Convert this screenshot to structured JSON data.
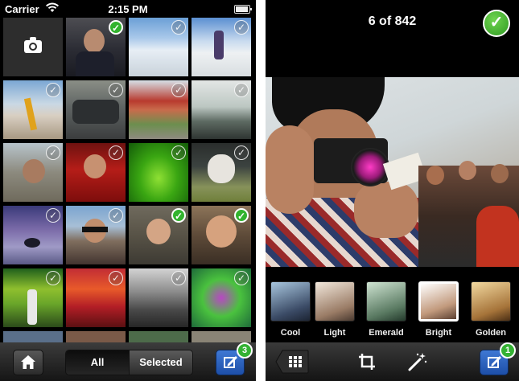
{
  "left_screen": {
    "status": {
      "carrier": "Carrier",
      "time": "2:15 PM"
    },
    "grid": {
      "camera_icon": "camera-icon",
      "tiles": [
        {
          "selected": false,
          "camera": true
        },
        {
          "selected": true
        },
        {
          "selected": false
        },
        {
          "selected": false
        },
        {
          "selected": false
        },
        {
          "selected": false
        },
        {
          "selected": false
        },
        {
          "selected": false
        },
        {
          "selected": false
        },
        {
          "selected": false
        },
        {
          "selected": false
        },
        {
          "selected": false
        },
        {
          "selected": false
        },
        {
          "selected": false
        },
        {
          "selected": true
        },
        {
          "selected": true
        },
        {
          "selected": false
        },
        {
          "selected": false
        },
        {
          "selected": false
        },
        {
          "selected": false
        }
      ]
    },
    "toolbar": {
      "home_icon": "home-icon",
      "segments": [
        "All",
        "Selected"
      ],
      "active_segment": "All",
      "compose_icon": "compose-icon",
      "compose_badge": "3"
    }
  },
  "right_screen": {
    "counter": "6 of 842",
    "done_icon": "checkmark-icon",
    "filters": [
      {
        "label": "Cool",
        "selected": false
      },
      {
        "label": "Light",
        "selected": false
      },
      {
        "label": "Emerald",
        "selected": false
      },
      {
        "label": "Bright",
        "selected": true
      },
      {
        "label": "Golden",
        "selected": false
      }
    ],
    "toolbar": {
      "grid_icon": "grid-icon",
      "crop_icon": "crop-icon",
      "magic_wand_icon": "magic-wand-icon",
      "compose_icon": "compose-icon",
      "compose_badge": "1"
    }
  },
  "colors": {
    "accent_blue": "#2a5fbf",
    "check_green": "#32b32e",
    "background": "#000000"
  }
}
